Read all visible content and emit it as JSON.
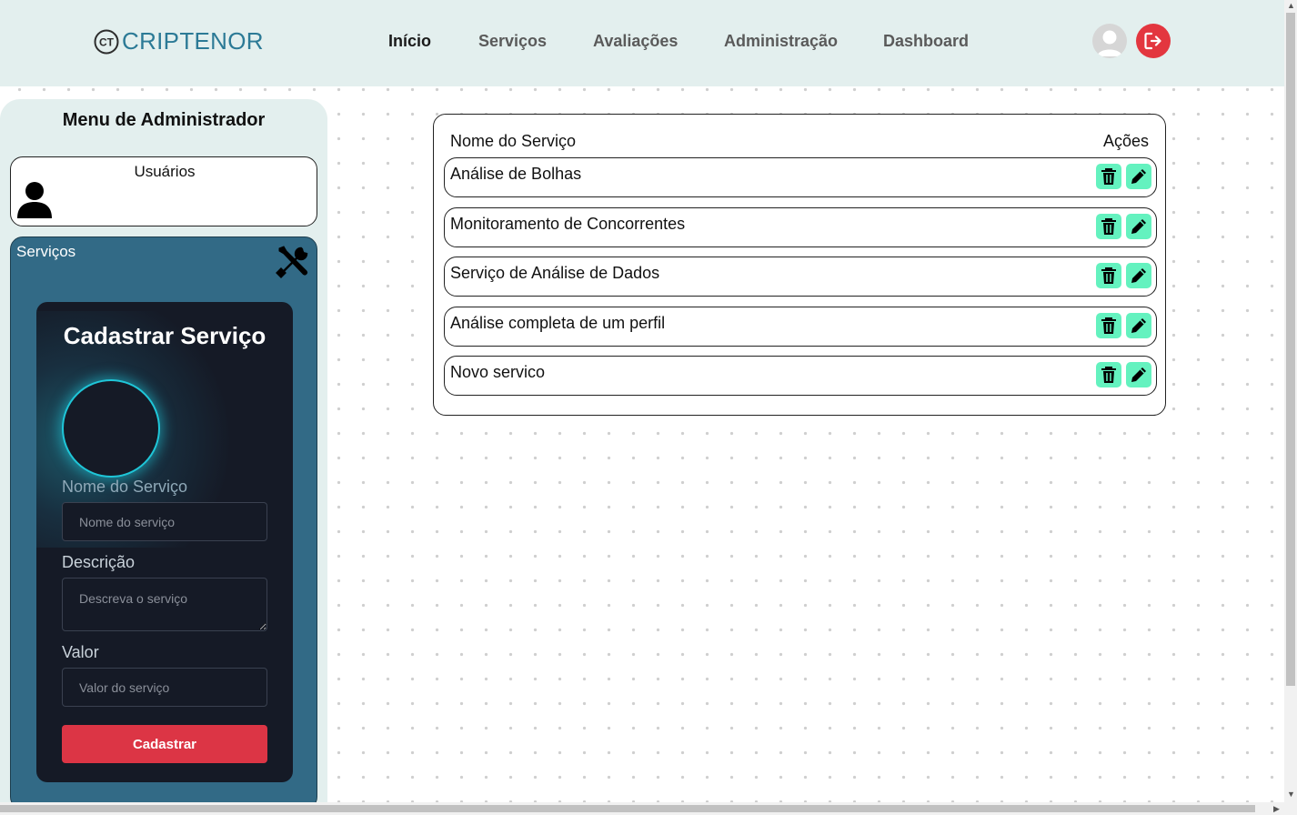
{
  "header": {
    "logo_mark": "CT",
    "logo_text": "CRIPTENOR",
    "nav": [
      "Início",
      "Serviços",
      "Avaliações",
      "Administração",
      "Dashboard"
    ],
    "active_nav": "Início",
    "avatar_icon": "user-avatar-icon",
    "logout_icon": "logout-icon"
  },
  "sidebar": {
    "title": "Menu de Administrador",
    "users_label": "Usuários",
    "services_label": "Serviços",
    "form": {
      "title": "Cadastrar Serviço",
      "name_label": "Nome do Serviço",
      "name_placeholder": "Nome do serviço",
      "desc_label": "Descrição",
      "desc_placeholder": "Descreva o serviço",
      "value_label": "Valor",
      "value_placeholder": "Valor do serviço",
      "submit": "Cadastrar"
    }
  },
  "table": {
    "col_name": "Nome do Serviço",
    "col_actions": "Ações",
    "rows": [
      "Análise de Bolhas",
      "Monitoramento de Concorrentes",
      "Serviço de Análise de Dados",
      "Análise completa de um perfil",
      "Novo servico"
    ]
  },
  "colors": {
    "header_bg": "#e3efee",
    "brand": "#2c7a96",
    "services_card": "#326a86",
    "form_bg": "#151a26",
    "submit": "#dc3545",
    "action_button": "#64f2bf",
    "logout": "#e3363f"
  }
}
